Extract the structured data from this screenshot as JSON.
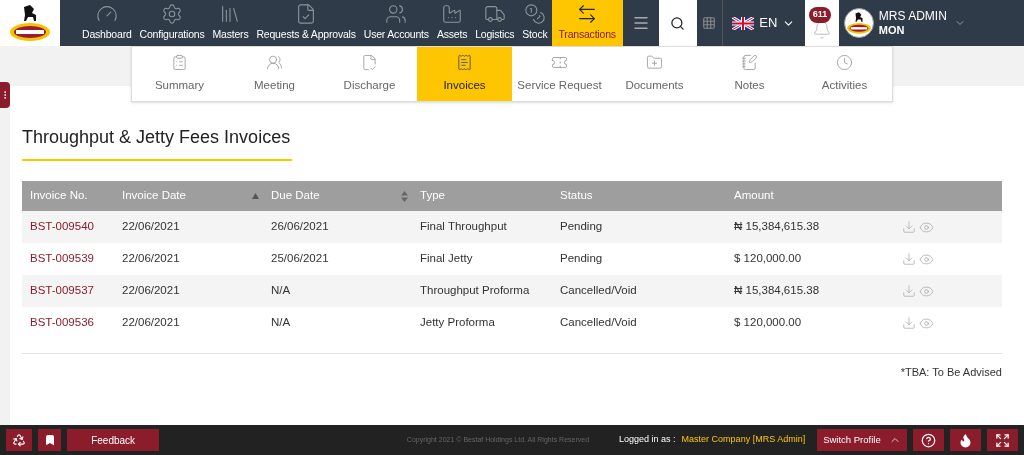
{
  "nav": {
    "items": [
      {
        "label": "Dashboard",
        "selected": false
      },
      {
        "label": "Configurations",
        "selected": false
      },
      {
        "label": "Masters",
        "selected": false
      },
      {
        "label": "Requests & Approvals",
        "selected": false
      },
      {
        "label": "User Accounts",
        "selected": false
      },
      {
        "label": "Assets",
        "selected": false
      },
      {
        "label": "Logistics",
        "selected": false
      },
      {
        "label": "Stock",
        "selected": false
      },
      {
        "label": "Transactions",
        "selected": true
      }
    ],
    "language": "EN",
    "notifications": "611",
    "user": {
      "name": "MRS ADMIN",
      "role": "MON"
    }
  },
  "subnav": [
    {
      "label": "Summary",
      "selected": false
    },
    {
      "label": "Meeting",
      "selected": false
    },
    {
      "label": "Discharge",
      "selected": false
    },
    {
      "label": "Invoices",
      "selected": true
    },
    {
      "label": "Service Request",
      "selected": false
    },
    {
      "label": "Documents",
      "selected": false
    },
    {
      "label": "Notes",
      "selected": false
    },
    {
      "label": "Activities",
      "selected": false
    }
  ],
  "page": {
    "title": "Throughput & Jetty Fees Invoices"
  },
  "table": {
    "columns": [
      {
        "label": "Invoice No.",
        "kind": "plain"
      },
      {
        "label": "Invoice Date",
        "kind": "sorted"
      },
      {
        "label": "Due Date",
        "kind": "sortable"
      },
      {
        "label": "Type",
        "kind": "plain"
      },
      {
        "label": "Status",
        "kind": "plain"
      },
      {
        "label": "Amount",
        "kind": "plain"
      }
    ],
    "rows": [
      {
        "invoice_no": "BST-009540",
        "invoice_date": "22/06/2021",
        "due_date": "26/06/2021",
        "type": "Final Throughput",
        "status": "Pending",
        "amount": "₦ 15,384,615.38"
      },
      {
        "invoice_no": "BST-009539",
        "invoice_date": "22/06/2021",
        "due_date": "25/06/2021",
        "type": "Final Jetty",
        "status": "Pending",
        "amount": "$ 120,000.00"
      },
      {
        "invoice_no": "BST-009537",
        "invoice_date": "22/06/2021",
        "due_date": "N/A",
        "type": "Throughput Proforma",
        "status": "Cancelled/Void",
        "amount": "₦ 15,384,615.38"
      },
      {
        "invoice_no": "BST-009536",
        "invoice_date": "22/06/2021",
        "due_date": "N/A",
        "type": "Jetty Proforma",
        "status": "Cancelled/Void",
        "amount": "$ 120,000.00"
      }
    ]
  },
  "note": "*TBA: To Be Advised",
  "footer": {
    "feedback": "Feedback",
    "copyright": "Copyright 2021 © Bestaf Holdings Ltd. All Rights Reserved",
    "logged_in_label": "Logged in as :",
    "logged_in_value": "Master Company [MRS Admin]",
    "switch_profile": "Switch Profile"
  }
}
